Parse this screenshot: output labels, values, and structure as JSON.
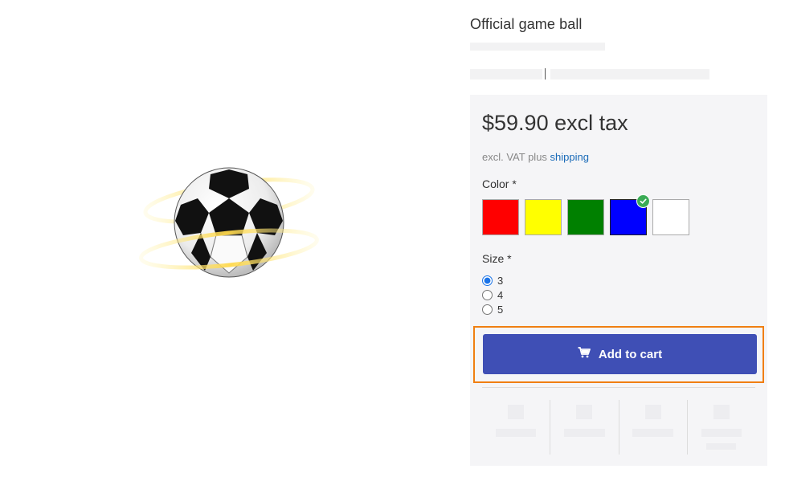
{
  "product": {
    "title": "Official game ball",
    "price": "$59.90 excl tax",
    "vat_text": "excl. VAT plus",
    "vat_link": "shipping"
  },
  "options": {
    "color_label": "Color *",
    "size_label": "Size *",
    "colors": [
      {
        "name": "red",
        "hex": "#ff0000"
      },
      {
        "name": "yellow",
        "hex": "#ffff00"
      },
      {
        "name": "green",
        "hex": "#008000"
      },
      {
        "name": "blue",
        "hex": "#0000ff",
        "selected": true
      },
      {
        "name": "white",
        "hex": "#ffffff"
      }
    ],
    "sizes": [
      "3",
      "4",
      "5"
    ],
    "selected_size": "3"
  },
  "cart": {
    "button_label": "Add to cart",
    "icon": "cart-icon"
  },
  "theme": {
    "accent": "#3f4fb5",
    "highlight": "#f07f12",
    "check": "#3aab55",
    "link": "#1a6bb8"
  }
}
